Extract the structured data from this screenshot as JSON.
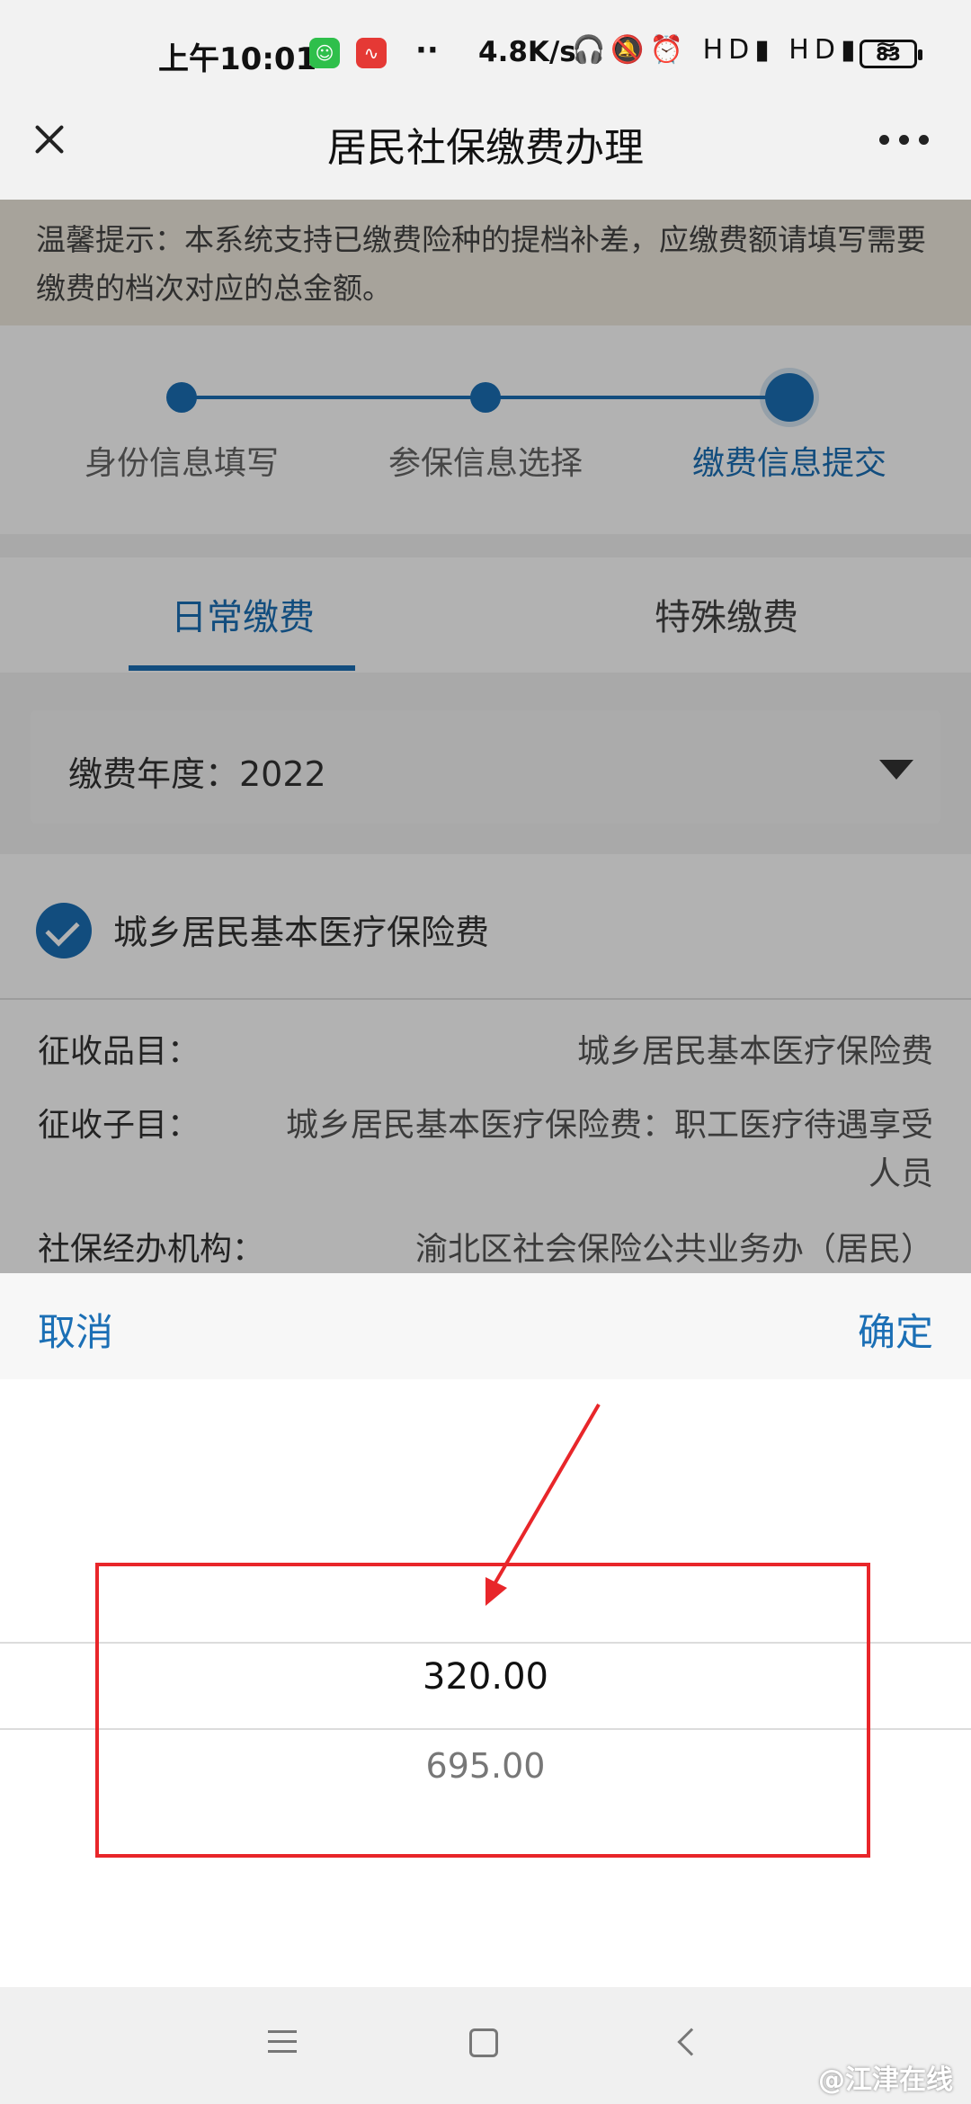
{
  "status_bar": {
    "time": "上午10:01",
    "dots": "··",
    "speed": "4.8K/s",
    "icons": "🎧🔕⏰ HD▮ HD▮ ≋",
    "battery": "83"
  },
  "header": {
    "title": "居民社保缴费办理"
  },
  "notice": {
    "text": "温馨提示：本系统支持已缴费险种的提档补差，应缴费额请填写需要缴费的档次对应的总金额。"
  },
  "steps": [
    {
      "label": "身份信息填写"
    },
    {
      "label": "参保信息选择"
    },
    {
      "label": "缴费信息提交"
    }
  ],
  "tabs": [
    {
      "label": "日常缴费"
    },
    {
      "label": "特殊缴费"
    }
  ],
  "year_select": {
    "text": "缴费年度：2022"
  },
  "insurance_item": {
    "label": "城乡居民基本医疗保险费"
  },
  "info_rows": [
    {
      "label": "征收品目：",
      "value": "城乡居民基本医疗保险费"
    },
    {
      "label": "征收子目：",
      "value_line1": "城乡居民基本医疗保险费：职工医疗待遇享受",
      "value_line2": "人员"
    },
    {
      "label": "社保经办机构：",
      "value": "渝北区社会保险公共业务办（居民）"
    }
  ],
  "picker": {
    "cancel": "取消",
    "confirm": "确定",
    "options": [
      "320.00",
      "695.00"
    ]
  },
  "watermark": "@江津在线",
  "colors": {
    "accent": "#1b6fb5",
    "highlight": "#e8262a"
  }
}
